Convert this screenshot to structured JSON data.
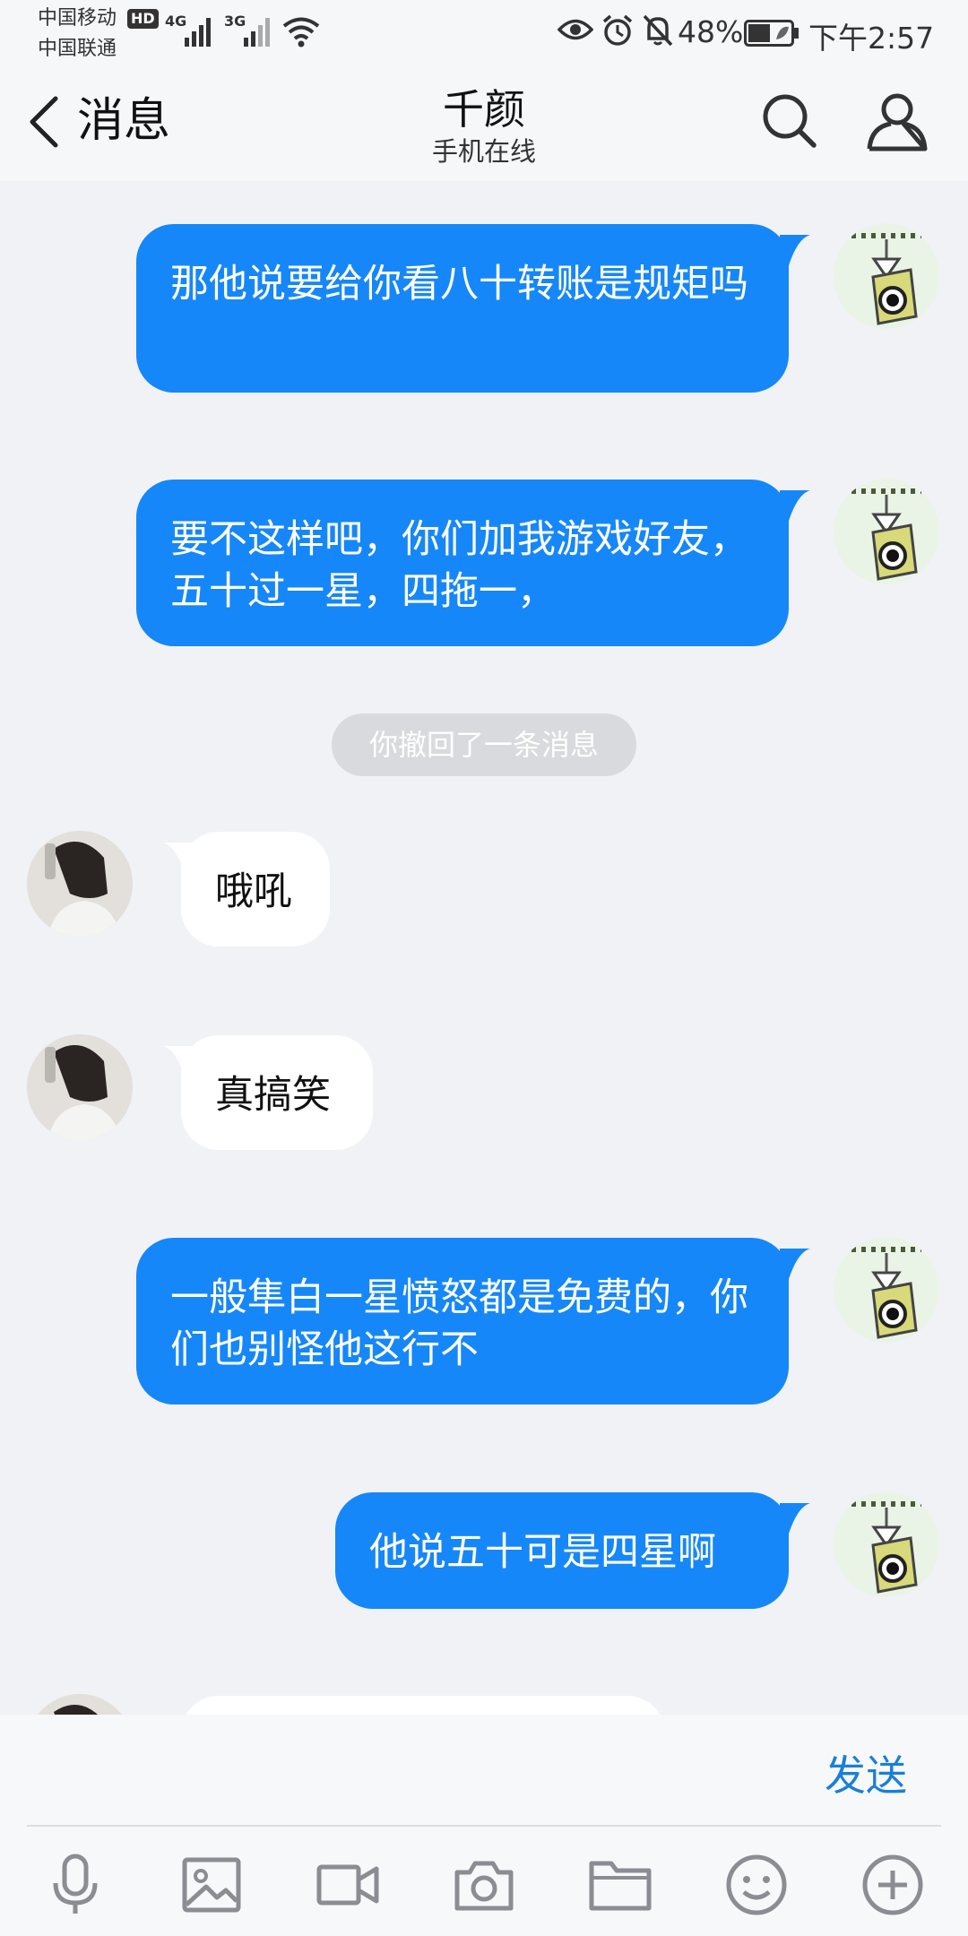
{
  "status_bar": {
    "carrier_1": "中国移动",
    "carrier_2": "中国联通",
    "hd_badge": "HD",
    "network_1": "4G",
    "network_2": "3G",
    "battery_percent": "48%",
    "time": "下午2:57"
  },
  "nav": {
    "back_label": "消息",
    "title": "千颜",
    "subtitle": "手机在线"
  },
  "messages": [
    {
      "from": "me",
      "text": "那他说要给你看八十转账是规矩吗"
    },
    {
      "from": "me",
      "text": "要不这样吧，你们加我游戏好友，五十过一星，四拖一，"
    },
    {
      "from": "system",
      "text": "你撤回了一条消息"
    },
    {
      "from": "other",
      "text": "哦吼"
    },
    {
      "from": "other",
      "text": "真搞笑"
    },
    {
      "from": "me",
      "text": "一般隼白一星愤怒都是免费的，你们也别怪他这行不"
    },
    {
      "from": "me",
      "text": "他说五十可是四星啊"
    }
  ],
  "input": {
    "placeholder": "",
    "send_label": "发送"
  },
  "toolbar": [
    "microphone-icon",
    "image-icon",
    "video-icon",
    "camera-icon",
    "folder-icon",
    "emoji-icon",
    "plus-icon"
  ],
  "colors": {
    "outgoing_bubble": "#1687f8",
    "incoming_bubble": "#ffffff",
    "background": "#f1f2f6",
    "send_text": "#1a7fd6"
  }
}
